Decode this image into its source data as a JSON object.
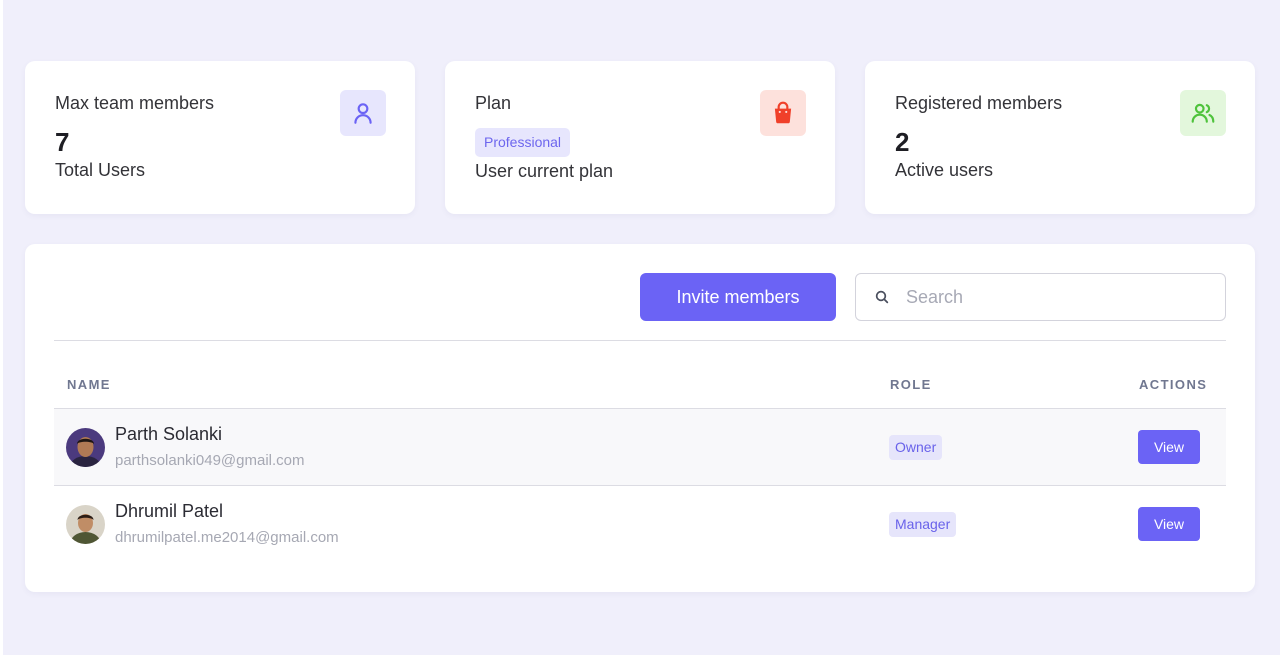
{
  "stats": {
    "max_team": {
      "label": "Max team members",
      "value": "7",
      "sub": "Total Users",
      "icon": "user-icon",
      "icon_bg": "#e7e6fd",
      "icon_color": "#6b63f5"
    },
    "plan": {
      "label": "Plan",
      "badge": "Professional",
      "sub": "User current plan",
      "icon": "shopping-bag-icon",
      "icon_bg": "#fde1dc",
      "icon_color": "#f0402a"
    },
    "registered": {
      "label": "Registered members",
      "value": "2",
      "sub": "Active users",
      "icon": "users-icon",
      "icon_bg": "#e3f7dc",
      "icon_color": "#4fc33c"
    }
  },
  "toolbar": {
    "invite_label": "Invite members",
    "search_placeholder": "Search",
    "search_value": ""
  },
  "table": {
    "headers": {
      "name": "NAME",
      "role": "ROLE",
      "actions": "ACTIONS"
    },
    "rows": [
      {
        "name": "Parth Solanki",
        "email": "parthsolanki049@gmail.com",
        "role": "Owner",
        "action": "View"
      },
      {
        "name": "Dhrumil Patel",
        "email": "dhrumilpatel.me2014@gmail.com",
        "role": "Manager",
        "action": "View"
      }
    ]
  },
  "colors": {
    "page_bg": "#f0effb",
    "accent": "#6b63f5",
    "badge_bg": "#e7e6fd"
  }
}
